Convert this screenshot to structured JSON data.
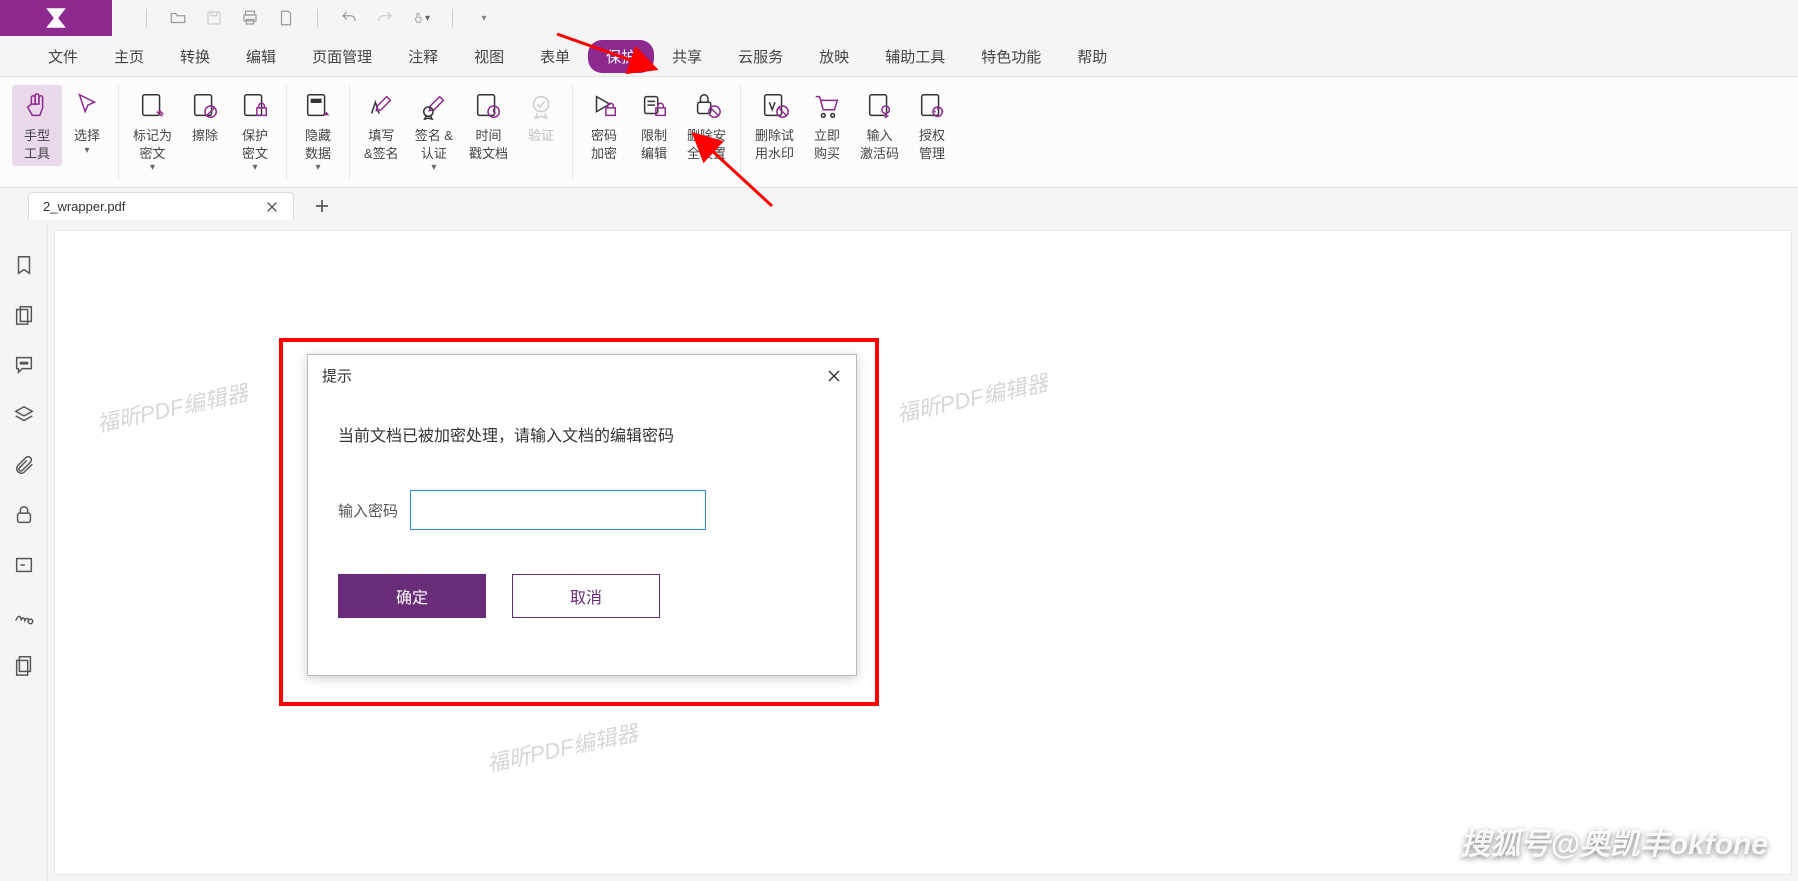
{
  "colors": {
    "brand": "#8e2a8f",
    "accent": "#6a2d7a",
    "highlight": "#ff0000",
    "input_border": "#2d88d8"
  },
  "menubar": {
    "items": [
      "文件",
      "主页",
      "转换",
      "编辑",
      "页面管理",
      "注释",
      "视图",
      "表单",
      "保护",
      "共享",
      "云服务",
      "放映",
      "辅助工具",
      "特色功能",
      "帮助"
    ],
    "active_index": 8
  },
  "ribbon": {
    "groups": [
      {
        "items": [
          {
            "name": "hand-tool",
            "label": "手型\n工具",
            "active": true
          },
          {
            "name": "select-tool",
            "label": "选择",
            "dropdown": true
          }
        ]
      },
      {
        "items": [
          {
            "name": "mark-redact",
            "label": "标记为\n密文",
            "dropdown": true
          },
          {
            "name": "erase",
            "label": "擦除"
          },
          {
            "name": "protect-redact",
            "label": "保护\n密文",
            "dropdown": true
          }
        ]
      },
      {
        "items": [
          {
            "name": "hidden-data",
            "label": "隐藏\n数据",
            "dropdown": true
          }
        ]
      },
      {
        "items": [
          {
            "name": "fill-sign",
            "label": "填写\n&签名"
          },
          {
            "name": "sign-cert",
            "label": "签名 &\n认证",
            "dropdown": true
          },
          {
            "name": "timestamp",
            "label": "时间\n戳文档"
          },
          {
            "name": "validate",
            "label": "验证",
            "disabled": true
          }
        ]
      },
      {
        "items": [
          {
            "name": "password-encrypt",
            "label": "密码\n加密"
          },
          {
            "name": "restrict-edit",
            "label": "限制\n编辑"
          },
          {
            "name": "remove-security",
            "label": "删除安\n全设置"
          }
        ]
      },
      {
        "items": [
          {
            "name": "remove-trial-wm",
            "label": "删除试\n用水印"
          },
          {
            "name": "buy-now",
            "label": "立即\n购买"
          },
          {
            "name": "enter-code",
            "label": "输入\n激活码"
          },
          {
            "name": "license-mgmt",
            "label": "授权\n管理"
          }
        ]
      }
    ]
  },
  "tabs": {
    "open": [
      {
        "title": "2_wrapper.pdf"
      }
    ]
  },
  "watermark_text": "福昕PDF编辑器",
  "dialog": {
    "title": "提示",
    "message": "当前文档已被加密处理，请输入文档的编辑密码",
    "input_label": "输入密码",
    "input_value": "",
    "ok": "确定",
    "cancel": "取消"
  },
  "attribution": "搜狐号@奥凯丰okfone"
}
